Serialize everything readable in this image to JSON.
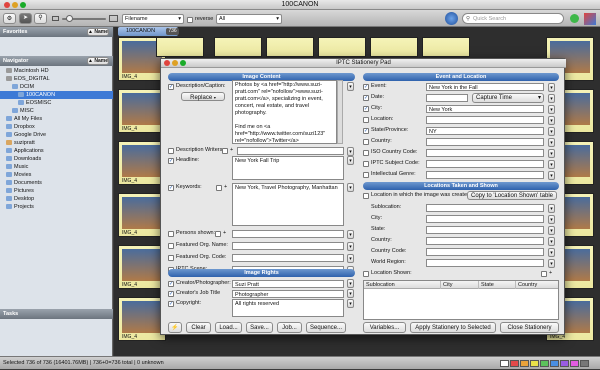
{
  "window": {
    "title": "100CANON"
  },
  "toolbar": {
    "sort_field": "Filename",
    "reverse_label": "reverse",
    "filter": "All",
    "search_placeholder": "Quick Search"
  },
  "sidebar": {
    "favorites_label": "Favorites",
    "navigator_label": "Navigator",
    "tasks_label": "Tasks",
    "name_btn": "▲ Name",
    "items": [
      {
        "label": "Macintosh HD",
        "color": "#9a9a9a"
      },
      {
        "label": "EOS_DIGITAL",
        "color": "#9a9a9a"
      },
      {
        "label": "DCIM",
        "color": "#7fa6d9"
      },
      {
        "label": "100CANON",
        "color": "#7fa6d9"
      },
      {
        "label": "EOSMISC",
        "color": "#7fa6d9"
      },
      {
        "label": "MISC",
        "color": "#7fa6d9"
      },
      {
        "label": "All My Files",
        "color": "#7fa6d9"
      },
      {
        "label": "Dropbox",
        "color": "#7fa6d9"
      },
      {
        "label": "Google Drive",
        "color": "#7fa6d9"
      },
      {
        "label": "suzipratt",
        "color": "#d9a660"
      },
      {
        "label": "Applications",
        "color": "#7fa6d9"
      },
      {
        "label": "Downloads",
        "color": "#7fa6d9"
      },
      {
        "label": "Music",
        "color": "#7fa6d9"
      },
      {
        "label": "Movies",
        "color": "#7fa6d9"
      },
      {
        "label": "Documents",
        "color": "#7fa6d9"
      },
      {
        "label": "Pictures",
        "color": "#7fa6d9"
      },
      {
        "label": "Desktop",
        "color": "#7fa6d9"
      },
      {
        "label": "Projects",
        "color": "#7fa6d9"
      }
    ]
  },
  "browser": {
    "folder_tab": "100CANON",
    "count_badge": "736",
    "thumb_labels": [
      "IMG_4"
    ]
  },
  "status": {
    "text": "Selected 736 of 736 (16401.76MB) | 736+0=736 total | 0 unknown"
  },
  "dialog": {
    "title": "IPTC Stationery Pad",
    "image_content": "Image Content",
    "description_label": "Description/Caption:",
    "replace_btn": "Replace",
    "description_text": "Photos by <a href=\"http://www.suzi-pratt.com\" rel=\"nofollow\">www.suzi-pratt.com</a>, specializing in event, concert, real estate, and travel photography.\n\nFind me on <a href=\"http://www.twitter.com/suzi123\" rel=\"nofollow\">Twitter</a>\n\nFind me on <a href=\"http://",
    "writers_label": "Description Writers:",
    "headline_label": "Headline:",
    "headline_value": "New York Fall Trip",
    "keywords_label": "Keywords:",
    "keywords_value": "New York, Travel Photography, Manhattan",
    "persons_label": "Persons shown:",
    "org_name_label": "Featured Org. Name:",
    "org_code_label": "Featured Org. Code:",
    "scene_label": "IPTC Scene:",
    "image_rights": "Image Rights",
    "creator_label": "Creator/Photographer:",
    "creator_value": "Suzi Pratt",
    "job_title_label": "Creator's Job Title",
    "job_title_value": "Photographer",
    "copyright_label": "Copyright:",
    "copyright_value": "All rights reserved",
    "event_location": "Event and Location",
    "event_label": "Event:",
    "event_value": "New York in the Fall",
    "date_label": "Date:",
    "date_value": "Capture Time",
    "city_label": "City:",
    "city_value": "New York",
    "location_label": "Location:",
    "state_label": "State/Province:",
    "state_value": "NY",
    "country_label": "Country:",
    "iso_label": "ISO Country Code:",
    "subject_label": "IPTC Subject Code:",
    "genre_label": "Intellectual Genre:",
    "locations_shown": "Locations Taken and Shown",
    "loc_created_label": "Location in which the image was created:",
    "copy_btn": "Copy to 'Location Shown' table",
    "sublocation_label": "Sublocation:",
    "city2_label": "City:",
    "state2_label": "State:",
    "country2_label": "Country:",
    "country_code_label": "Country Code:",
    "world_region_label": "World Region:",
    "loc_shown_label": "Location Shown:",
    "columns": [
      "Sublocation",
      "City",
      "State",
      "Country"
    ],
    "buttons": {
      "lightning": "⚡",
      "clear": "Clear",
      "load": "Load...",
      "save": "Save...",
      "job": "Job...",
      "sequence": "Sequence...",
      "variables": "Variables...",
      "apply": "Apply Stationery to Selected",
      "close": "Close Stationery"
    }
  }
}
